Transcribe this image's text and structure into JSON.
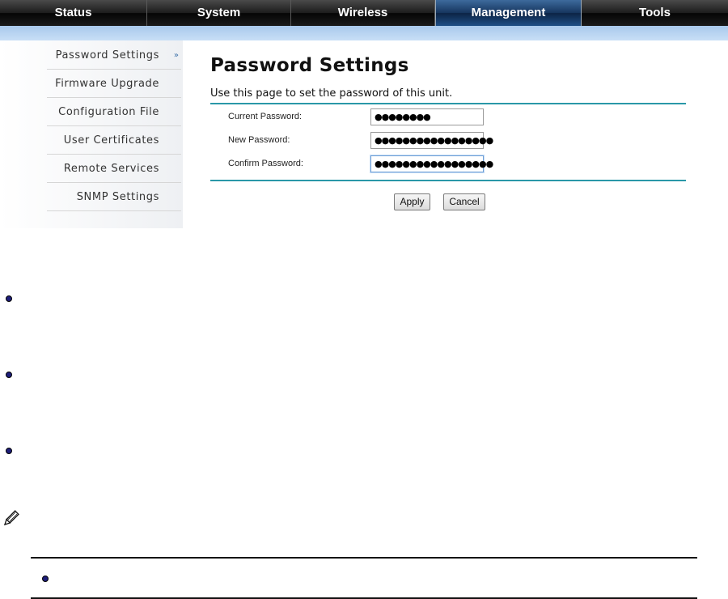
{
  "nav": {
    "tabs": [
      {
        "label": "Status"
      },
      {
        "label": "System"
      },
      {
        "label": "Wireless"
      },
      {
        "label": "Management",
        "active": true
      },
      {
        "label": "Tools"
      }
    ]
  },
  "sidebar": {
    "items": [
      {
        "label": "Password Settings",
        "active": true
      },
      {
        "label": "Firmware Upgrade"
      },
      {
        "label": "Configuration File"
      },
      {
        "label": "User Certificates"
      },
      {
        "label": "Remote Services"
      },
      {
        "label": "SNMP Settings"
      }
    ],
    "active_marker": "»"
  },
  "main": {
    "title": "Password Settings",
    "description": "Use this page to set the password of this unit.",
    "fields": [
      {
        "label": "Current Password:",
        "value": "●●●●●●●●"
      },
      {
        "label": "New Password:",
        "value": "●●●●●●●●●●●●●●●●●"
      },
      {
        "label": "Confirm Password:",
        "value": "●●●●●●●●●●●●●●●●●"
      }
    ],
    "apply_label": "Apply",
    "cancel_label": "Cancel"
  },
  "colors": {
    "accent_rule": "#2a98a8",
    "active_tab": "#1f4f86",
    "bullet": "#1e1e7a"
  },
  "icons": {
    "note": "pencil-icon",
    "bullet": "bullet-icon"
  }
}
